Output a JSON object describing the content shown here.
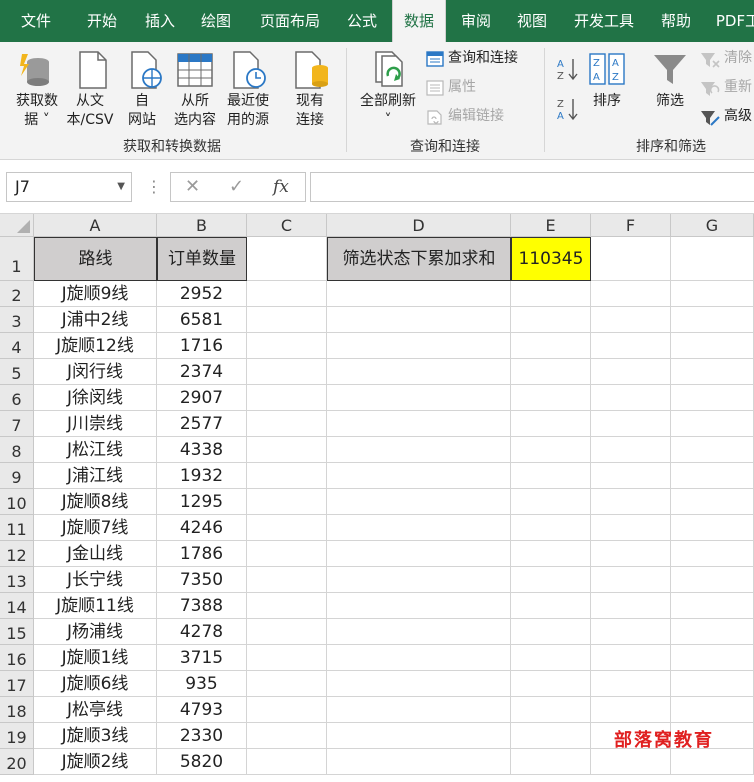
{
  "tabs": [
    "文件",
    "开始",
    "插入",
    "绘图",
    "页面布局",
    "公式",
    "数据",
    "审阅",
    "视图",
    "开发工具",
    "帮助",
    "PDF工"
  ],
  "active_tab": "数据",
  "ribbon": {
    "get_data": {
      "line1": "获取数",
      "line2": "据 ˅"
    },
    "from_text": {
      "line1": "从文",
      "line2": "本/CSV"
    },
    "from_web": {
      "line1": "自",
      "line2": "网站"
    },
    "from_table": {
      "line1": "从所",
      "line2": "选内容"
    },
    "recent_sources": {
      "line1": "最近使",
      "line2": "用的源"
    },
    "existing_connections": {
      "line1": "现有",
      "line2": "连接"
    },
    "group_get_transform": "获取和转换数据",
    "refresh_all": {
      "line1": "全部刷新",
      "line2": "˅"
    },
    "queries_connections": "查询和连接",
    "properties": "属性",
    "edit_links": "编辑链接",
    "group_queries": "查询和连接",
    "sort_az": "A↓Z",
    "sort_za": "Z↓A",
    "sort": "排序",
    "filter": "筛选",
    "clear": "清除",
    "reapply": "重新",
    "advanced": "高级",
    "group_sort_filter": "排序和筛选"
  },
  "formula_bar": {
    "name_box": "J7",
    "cancel_glyph": "✕",
    "enter_glyph": "✓",
    "fx": "fx",
    "formula": ""
  },
  "columns": [
    "A",
    "B",
    "C",
    "D",
    "E",
    "F",
    "G"
  ],
  "sheet": {
    "header_route": "路线",
    "header_orders": "订单数量",
    "filter_label": "筛选状态下累加求和",
    "filter_sum": "110345",
    "rows": [
      {
        "n": "2",
        "route": "J旋顺9线",
        "qty": "2952"
      },
      {
        "n": "3",
        "route": "J浦中2线",
        "qty": "6581"
      },
      {
        "n": "4",
        "route": "J旋顺12线",
        "qty": "1716"
      },
      {
        "n": "5",
        "route": "J闵行线",
        "qty": "2374"
      },
      {
        "n": "6",
        "route": "J徐闵线",
        "qty": "2907"
      },
      {
        "n": "7",
        "route": "J川崇线",
        "qty": "2577"
      },
      {
        "n": "8",
        "route": "J松江线",
        "qty": "4338"
      },
      {
        "n": "9",
        "route": "J浦江线",
        "qty": "1932"
      },
      {
        "n": "10",
        "route": "J旋顺8线",
        "qty": "1295"
      },
      {
        "n": "11",
        "route": "J旋顺7线",
        "qty": "4246"
      },
      {
        "n": "12",
        "route": "J金山线",
        "qty": "1786"
      },
      {
        "n": "13",
        "route": "J长宁线",
        "qty": "7350"
      },
      {
        "n": "14",
        "route": "J旋顺11线",
        "qty": "7388"
      },
      {
        "n": "15",
        "route": "J杨浦线",
        "qty": "4278"
      },
      {
        "n": "16",
        "route": "J旋顺1线",
        "qty": "3715"
      },
      {
        "n": "17",
        "route": "J旋顺6线",
        "qty": "935"
      },
      {
        "n": "18",
        "route": "J松亭线",
        "qty": "4793"
      },
      {
        "n": "19",
        "route": "J旋顺3线",
        "qty": "2330"
      },
      {
        "n": "20",
        "route": "J旋顺2线",
        "qty": "5820"
      }
    ]
  },
  "watermark": "部落窝教育",
  "colors": {
    "excel_green": "#217346",
    "header_gray": "#d0cece",
    "highlight_yellow": "#ffff00",
    "watermark_red": "#e02020"
  }
}
